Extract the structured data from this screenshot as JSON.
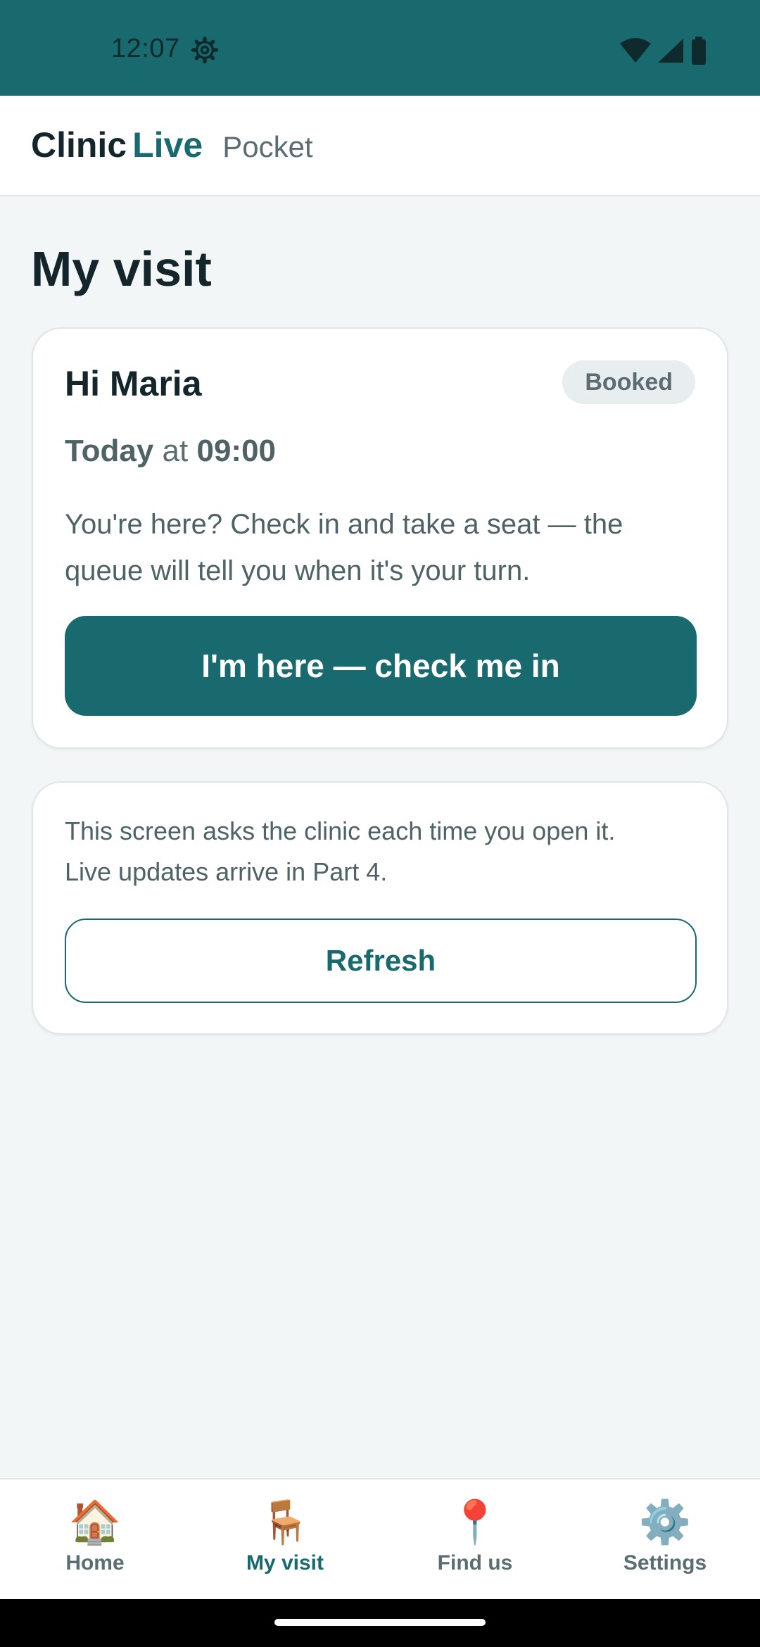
{
  "status_bar": {
    "time": "12:07",
    "icons": [
      "settings-gear-icon",
      "wifi-icon",
      "cellular-signal-icon",
      "battery-icon"
    ]
  },
  "header": {
    "brand_clinic": "Clinic",
    "brand_live": "Live",
    "brand_suffix": "Pocket"
  },
  "page": {
    "title": "My visit"
  },
  "visit_card": {
    "greeting": "Hi Maria",
    "status_badge": "Booked",
    "day": "Today",
    "at": "at",
    "time": "09:00",
    "message": "You're here? Check in and take a seat — the queue will tell you when it's your turn.",
    "check_in_label": "I'm here — check me in"
  },
  "info_card": {
    "line1": "This screen asks the clinic each time you open it.",
    "line2": "Live updates arrive in Part 4.",
    "refresh_label": "Refresh"
  },
  "bottom_nav": {
    "items": [
      {
        "label": "Home",
        "icon": "🏠",
        "icon_name": "house-icon"
      },
      {
        "label": "My visit",
        "icon": "🪑",
        "icon_name": "chair-icon",
        "active": true
      },
      {
        "label": "Find us",
        "icon": "📍",
        "icon_name": "map-pin-icon"
      },
      {
        "label": "Settings",
        "icon": "⚙️",
        "icon_name": "gear-icon"
      }
    ]
  },
  "colors": {
    "primary": "#196a6f",
    "background": "#f2f6f7",
    "text_dark": "#14262b",
    "text_muted": "#5b6d72"
  }
}
